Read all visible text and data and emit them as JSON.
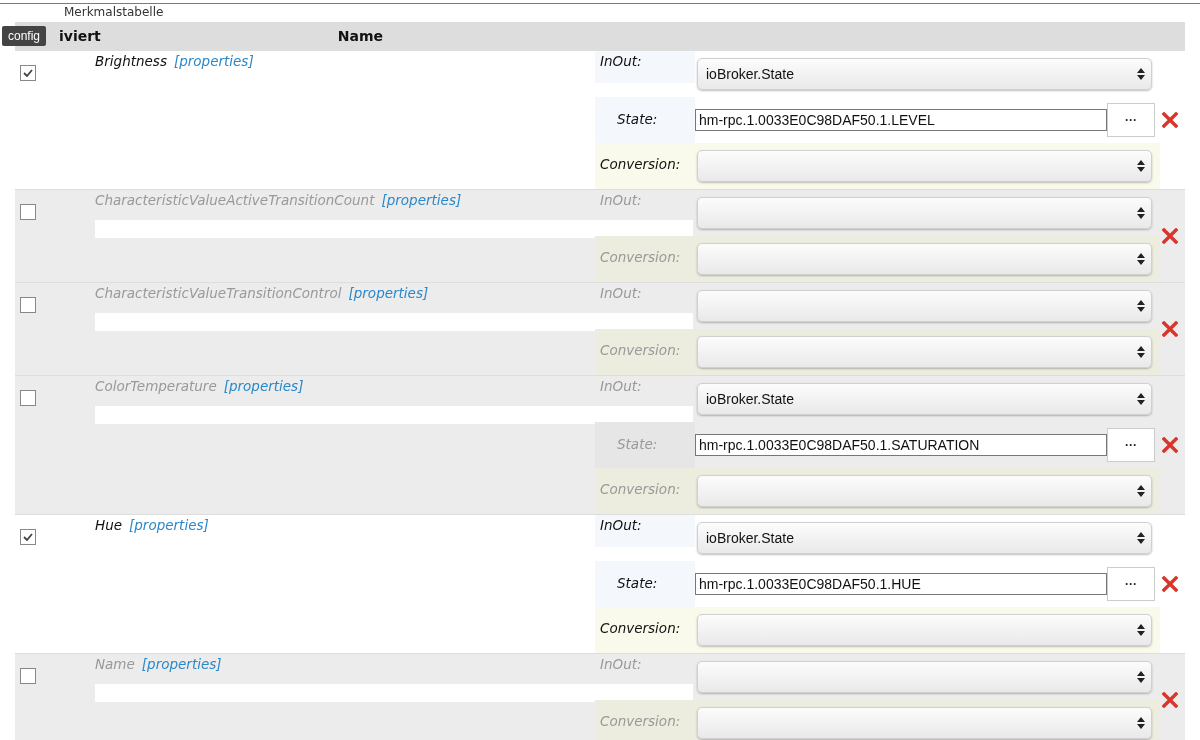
{
  "title": "Merkmalstabelle",
  "tooltip": "config",
  "columns": [
    "iviert",
    "Name"
  ],
  "rows": [
    {
      "enabled": true,
      "name": "Brightness",
      "link": "[properties]",
      "inout_label": "InOut:",
      "inout": "ioBroker.State",
      "state_label": "State:",
      "state": "hm-rpc.1.0033E0C98DAF50.1.LEVEL",
      "more_button": "···",
      "conversion_label": "Conversion:"
    },
    {
      "enabled": false,
      "name": "CharacteristicValueActiveTransitionCount",
      "link": "[properties]",
      "inout_label": "InOut:",
      "conversion_label": "Conversion:"
    },
    {
      "enabled": false,
      "name": "CharacteristicValueTransitionControl",
      "link": "[properties]",
      "inout_label": "InOut:",
      "conversion_label": "Conversion:"
    },
    {
      "enabled": false,
      "name": "ColorTemperature",
      "link": "[properties]",
      "inout_label": "InOut:",
      "inout": "ioBroker.State",
      "state_label": "State:",
      "state": "hm-rpc.1.0033E0C98DAF50.1.SATURATION",
      "more_button": "···",
      "conversion_label": "Conversion:"
    },
    {
      "enabled": true,
      "name": "Hue",
      "link": "[properties]",
      "inout_label": "InOut:",
      "inout": "ioBroker.State",
      "state_label": "State:",
      "state": "hm-rpc.1.0033E0C98DAF50.1.HUE",
      "more_button": "···",
      "conversion_label": "Conversion:"
    },
    {
      "enabled": false,
      "name": "Name",
      "link": "[properties]",
      "inout_label": "InOut:",
      "conversion_label": "Conversion:"
    }
  ]
}
